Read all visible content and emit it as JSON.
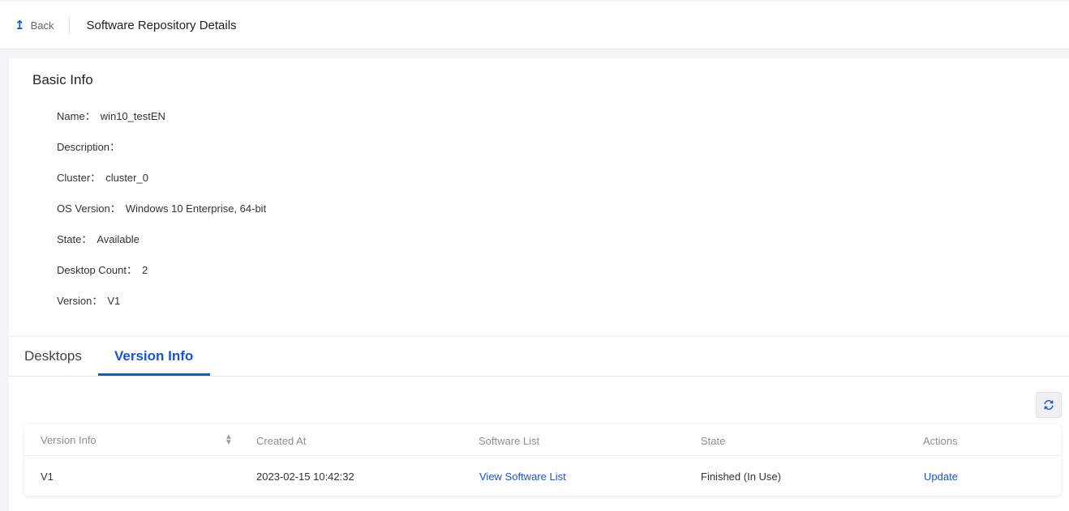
{
  "header": {
    "back_label": "Back",
    "title": "Software Repository Details"
  },
  "basic_info": {
    "heading": "Basic Info",
    "fields": [
      {
        "key": "Name：",
        "value": "win10_testEN"
      },
      {
        "key": "Description：",
        "value": ""
      },
      {
        "key": "Cluster：",
        "value": "cluster_0"
      },
      {
        "key": "OS Version：",
        "value": "Windows 10 Enterprise, 64-bit"
      },
      {
        "key": "State：",
        "value": "Available"
      },
      {
        "key": "Desktop Count：",
        "value": "2"
      },
      {
        "key": "Version：",
        "value": "V1"
      }
    ]
  },
  "tabs": [
    {
      "label": "Desktops",
      "active": false
    },
    {
      "label": "Version Info",
      "active": true
    }
  ],
  "table": {
    "columns": [
      "Version Info",
      "Created At",
      "Software List",
      "State",
      "Actions"
    ],
    "rows": [
      {
        "version": "V1",
        "created_at": "2023-02-15 10:42:32",
        "software_list": "View Software List",
        "state": "Finished (In Use)",
        "action": "Update"
      }
    ]
  },
  "colors": {
    "accent": "#1a56c8",
    "background": "#f3f4f6"
  },
  "icons": {
    "back": "back-arrow-icon",
    "refresh": "refresh-icon",
    "sort": "sort-icon"
  }
}
